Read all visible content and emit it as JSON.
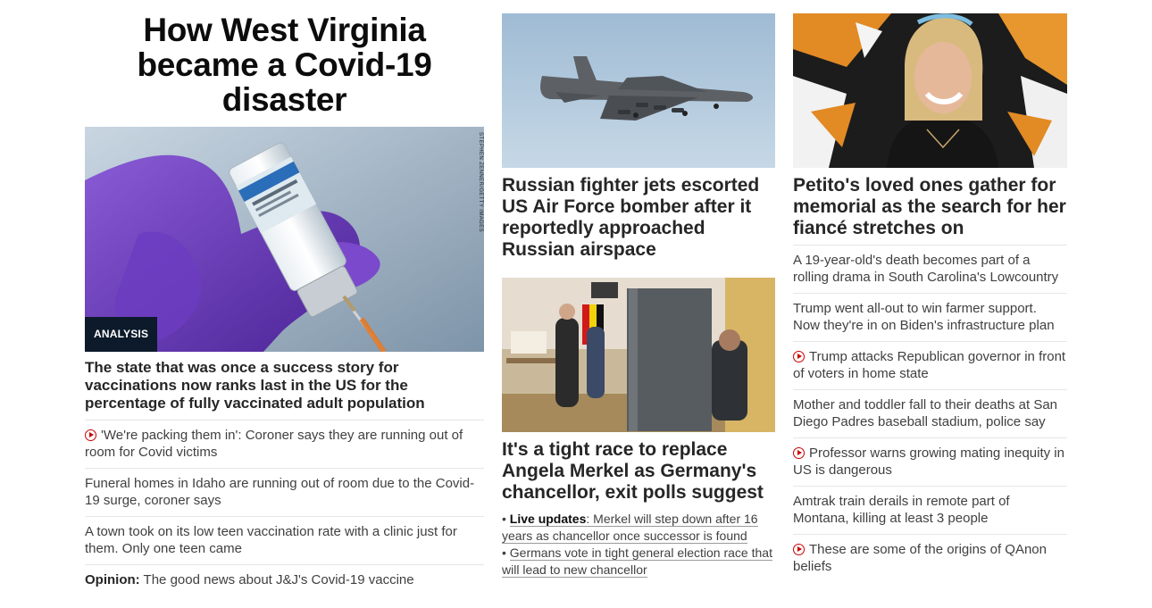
{
  "col1": {
    "title": "How West Virginia became a Covid-19 disaster",
    "image_credit": "STEPHEN ZENNER/GETTY IMAGES",
    "badge": "ANALYSIS",
    "lede": "The state that was once a success story for vaccinations now ranks last in the US for the percentage of fully vaccinated adult population",
    "items": [
      {
        "video": true,
        "text": "'We're packing them in': Coroner says they are running out of room for Covid victims"
      },
      {
        "video": false,
        "text": "Funeral homes in Idaho are running out of room due to the Covid-19 surge, coroner says"
      },
      {
        "video": false,
        "text": "A town took on its low teen vaccination rate with a clinic just for them. Only one teen came"
      }
    ],
    "opinion": {
      "label": "Opinion:",
      "text": " The good news about J&J's Covid-19 vaccine"
    }
  },
  "col2": {
    "story1": {
      "headline": "Russian fighter jets escorted US Air Force bomber after it reportedly approached Russian airspace"
    },
    "story2": {
      "headline": "It's a tight race to replace Angela Merkel as Germany's chancellor, exit polls suggest",
      "bullet1_prefix": "Live updates",
      "bullet1_text": ": Merkel will step down after 16 years as chancellor once successor is found",
      "bullet2_text": "Germans vote in tight general election race that will lead to new chancellor"
    }
  },
  "col3": {
    "headline": "Petito's loved ones gather for memorial as the search for her fiancé stretches on",
    "items": [
      {
        "video": false,
        "text": "A 19-year-old's death becomes part of a rolling drama in South Carolina's Lowcountry"
      },
      {
        "video": false,
        "text": "Trump went all-out to win farmer support. Now they're in on Biden's infrastructure plan"
      },
      {
        "video": true,
        "text": "Trump attacks Republican governor in front of voters in home state"
      },
      {
        "video": false,
        "text": "Mother and toddler fall to their deaths at San Diego Padres baseball stadium, police say"
      },
      {
        "video": true,
        "text": "Professor warns growing mating inequity in US is dangerous"
      },
      {
        "video": false,
        "text": "Amtrak train derails in remote part of Montana, killing at least 3 people"
      },
      {
        "video": true,
        "text": "These are some of the origins of QAnon beliefs"
      }
    ]
  }
}
